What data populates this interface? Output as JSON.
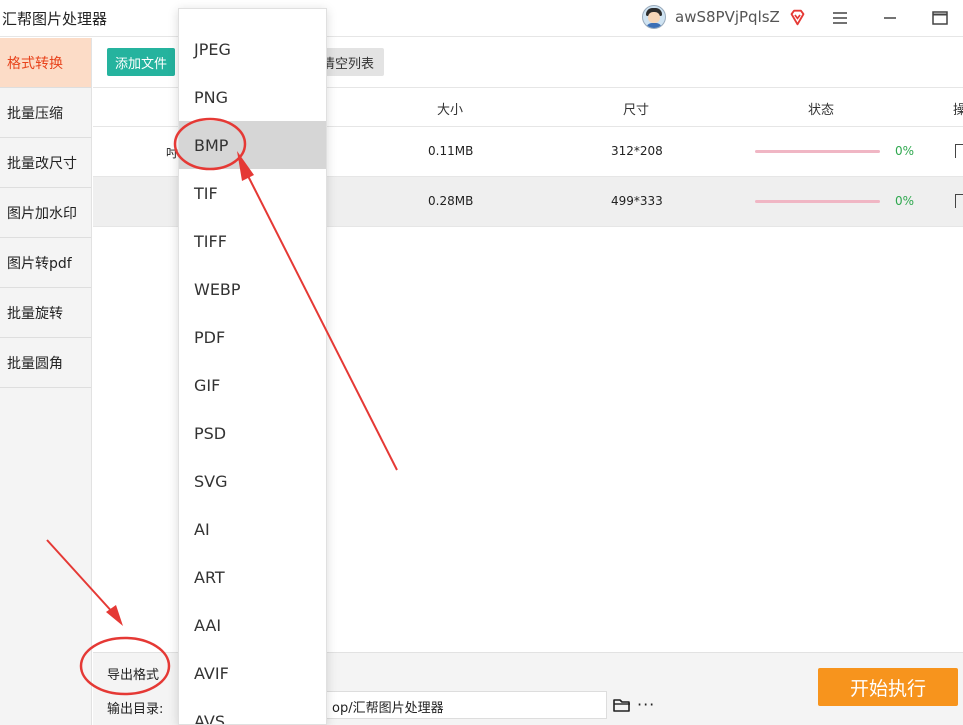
{
  "app": {
    "title": "汇帮图片处理器",
    "username": "awS8PVjPqlsZ"
  },
  "window_controls": {
    "menu_icon": "menu-icon",
    "minimize_icon": "minimize-icon",
    "maximize_icon": "maximize-icon"
  },
  "sidebar": {
    "items": [
      {
        "label": "格式转换"
      },
      {
        "label": "批量压缩"
      },
      {
        "label": "批量改尺寸"
      },
      {
        "label": "图片加水印"
      },
      {
        "label": "图片转pdf"
      },
      {
        "label": "批量旋转"
      },
      {
        "label": "批量圆角"
      }
    ],
    "active_index": 0,
    "active_color": "#e8431c"
  },
  "toolbar": {
    "add_file_label": "添加文件",
    "clear_list_label": "清空列表"
  },
  "table": {
    "headers": {
      "size": "大小",
      "dimensions": "尺寸",
      "status": "状态",
      "action": "操"
    },
    "rows": [
      {
        "name_fragment": "吋",
        "size": "0.11MB",
        "dimensions": "312*208",
        "progress_label": "0%",
        "progress": 0
      },
      {
        "name_fragment": "",
        "size": "0.28MB",
        "dimensions": "499*333",
        "progress_label": "0%",
        "progress": 0
      }
    ]
  },
  "bottom": {
    "export_format_label": "导出格式",
    "output_dir_label": "输出目录:",
    "output_dir_value": "op/汇帮图片处理器",
    "more_label": "···"
  },
  "start_button_label": "开始执行",
  "format_dropdown": {
    "options": [
      "JPEG",
      "PNG",
      "BMP",
      "TIF",
      "TIFF",
      "WEBP",
      "PDF",
      "GIF",
      "PSD",
      "SVG",
      "AI",
      "ART",
      "AAI",
      "AVIF",
      "AVS"
    ],
    "selected": "BMP"
  },
  "colors": {
    "accent_green": "#25b39e",
    "start_orange": "#f7941d",
    "annotation_red": "#e53935",
    "progress_pink": "#f0b6c4"
  }
}
